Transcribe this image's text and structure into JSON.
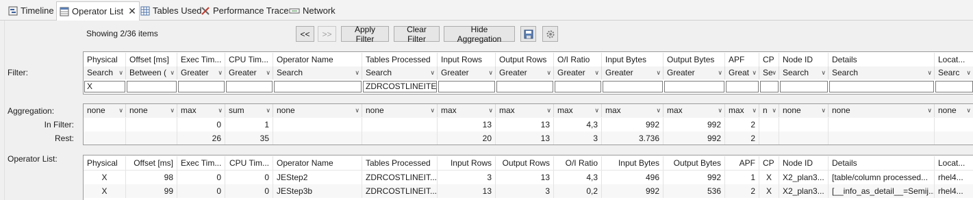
{
  "tabs": [
    {
      "label": "Timeline",
      "icon": "timeline-icon"
    },
    {
      "label": "Operator List",
      "icon": "table-icon",
      "active": true
    },
    {
      "label": "Tables Used",
      "icon": "grid-icon"
    },
    {
      "label": "Performance Trace",
      "icon": "tools-icon"
    },
    {
      "label": "Network",
      "icon": "network-icon"
    }
  ],
  "toolbar": {
    "showing": "Showing 2/36 items",
    "prev": "<<",
    "next": ">>",
    "apply_filter": "Apply Filter",
    "clear_filter": "Clear Filter",
    "hide_aggregation": "Hide Aggregation"
  },
  "labels": {
    "filter": "Filter:",
    "aggregation": "Aggregation:",
    "in_filter": "In Filter:",
    "rest": "Rest:",
    "operator_list": "Operator List:"
  },
  "columns": [
    "Physical",
    "Offset [ms]",
    "Exec Tim...",
    "CPU Tim...",
    "Operator Name",
    "Tables Processed",
    "Input Rows",
    "Output Rows",
    "O/I Ratio",
    "Input Bytes",
    "Output Bytes",
    "APF",
    "CP",
    "Node ID",
    "Details",
    "Locat..."
  ],
  "filter_modes": [
    "Search",
    "Between (",
    "Greater",
    "Greater",
    "Search",
    "Search",
    "Greater",
    "Greater",
    "Greater",
    "Greater",
    "Greater",
    "Great",
    "Se",
    "Search",
    "Search",
    "Searc"
  ],
  "filter_values": [
    "X",
    "",
    "",
    "",
    "",
    "ZDRCOSTLINEITEM",
    "",
    "",
    "",
    "",
    "",
    "",
    "",
    "",
    "",
    ""
  ],
  "aggregation_modes": [
    "none",
    "none",
    "max",
    "sum",
    "none",
    "none",
    "max",
    "max",
    "max",
    "max",
    "max",
    "max",
    "n",
    "none",
    "none",
    "none"
  ],
  "in_filter": [
    "",
    "",
    "0",
    "1",
    "",
    "",
    "13",
    "13",
    "4,3",
    "992",
    "992",
    "2",
    "",
    "",
    "",
    ""
  ],
  "rest": [
    "",
    "",
    "26",
    "35",
    "",
    "",
    "20",
    "13",
    "3",
    "3.736",
    "992",
    "2",
    "",
    "",
    "",
    ""
  ],
  "operator_rows": [
    [
      "X",
      "98",
      "0",
      "0",
      "JEStep2",
      "ZDRCOSTLINEIT...",
      "3",
      "13",
      "4,3",
      "496",
      "992",
      "1",
      "X",
      "X2_plan3...",
      "[table/column processed...",
      "rhel4..."
    ],
    [
      "X",
      "99",
      "0",
      "0",
      "JEStep3b",
      "ZDRCOSTLINEIT...",
      "13",
      "3",
      "0,2",
      "992",
      "536",
      "2",
      "X",
      "X2_plan3...",
      "[__info_as_detail__=Semij...",
      "rhel4..."
    ]
  ]
}
